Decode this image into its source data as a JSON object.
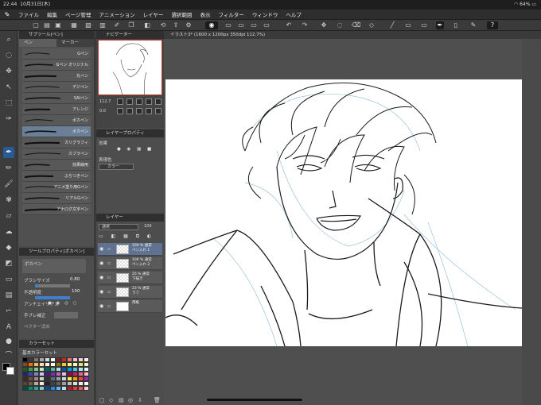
{
  "status": {
    "time": "22:44",
    "date": "10月31日(木)",
    "wifi": "wifi-icon",
    "battery": "64%"
  },
  "menu": [
    "ファイル",
    "編集",
    "ページ管理",
    "アニメーション",
    "レイヤー",
    "選択範囲",
    "表示",
    "フィルター",
    "ウィンドウ",
    "ヘルプ"
  ],
  "subtool": {
    "header": "サブツール[ペン]",
    "tabs": [
      "ペン",
      "マーカー"
    ],
    "brushes": [
      "Gペン",
      "Gペン オリジナル",
      "丸ペン",
      "デジペン",
      "SAIペン",
      "アレンジ",
      "ボカペン",
      "ボカペン",
      "カリグラフィ",
      "カブラペン",
      "効果線用",
      "ぶらつきペン",
      "アニメ塗り用Gペン",
      "リアルGペン",
      "アナログ文字ペン"
    ],
    "selected_index": 7
  },
  "toolprop": {
    "header": "ツールプロパティ[ボカペン]",
    "brush_name": "ボカペン",
    "brush_size_label": "ブラシサイズ",
    "brush_size_value": "0.80",
    "opacity_label": "不透明度",
    "opacity_value": "100",
    "opacity_fraction": 1.0,
    "brush_size_fraction": 0.08,
    "antialias_label": "アンチエイリアス",
    "stabilize_label": "手ブレ補正",
    "vector_label": "ベクター消去"
  },
  "colorset": {
    "header": "カラーセット",
    "set_name": "基本カラーセット"
  },
  "navigator": {
    "header": "ナビゲーター",
    "zoom": "112.7",
    "rotate": "0.0"
  },
  "layerprop": {
    "header": "レイヤープロパティ",
    "effect_label": "効果",
    "expression_label": "表現色",
    "color_value": "カラー"
  },
  "layers": {
    "header": "レイヤー",
    "blend_mode": "通常",
    "opacity": "100",
    "items": [
      {
        "line1": "100 % 通常",
        "line2": "ペン入れ 1"
      },
      {
        "line1": "100 % 通常",
        "line2": "ペン入れ 2"
      },
      {
        "line1": "25 % 通常",
        "line2": "下描き"
      },
      {
        "line1": "23 % 通常",
        "line2": "ラフ"
      },
      {
        "line1": "",
        "line2": "用紙"
      }
    ],
    "selected_index": 0
  },
  "canvas": {
    "tab_title": "イラスト3* (1600 x 1200px 350dpi 112.7%)"
  },
  "colors": {
    "accent": "#2a5a95",
    "panel_bg": "#4d4d4d",
    "selected_row": "#5f7391",
    "nav_border": "#c0392b"
  },
  "swatch_palette": [
    "#000000",
    "#3a3a3a",
    "#777777",
    "#aaaaaa",
    "#d9d9d9",
    "#ffffff",
    "#7a1f1f",
    "#c62828",
    "#e57373",
    "#f8bbd0",
    "#ffcdd2",
    "#fff0f0",
    "#8d4a12",
    "#ef6c00",
    "#ffb74d",
    "#ffe0b2",
    "#fff3e0",
    "#fffde7",
    "#827717",
    "#fbc02d",
    "#fff176",
    "#fff9c4",
    "#dce775",
    "#f0f4c3",
    "#1b5e20",
    "#43a047",
    "#81c784",
    "#c8e6c9",
    "#00695c",
    "#4db6ac",
    "#b2dfdb",
    "#01579b",
    "#039be5",
    "#4fc3f7",
    "#b3e5fc",
    "#e1f5fe",
    "#1a237e",
    "#3949ab",
    "#7986cb",
    "#c5cae9",
    "#4a148c",
    "#8e24aa",
    "#ba68c8",
    "#e1bee7",
    "#880e4f",
    "#d81b60",
    "#f06292",
    "#f8bbd0",
    "#3e2723",
    "#6d4c41",
    "#a1887f",
    "#d7ccc8",
    "#263238",
    "#546e7a",
    "#90a4ae",
    "#cfd8dc",
    "#ffeb3b",
    "#ff9800",
    "#f44336",
    "#9c27b0",
    "#5d4037",
    "#795548",
    "#bcaaa4",
    "#efebe9",
    "#212121",
    "#424242",
    "#616161",
    "#9e9e9e",
    "#bdbdbd",
    "#e0e0e0",
    "#eeeeee",
    "#fafafa",
    "#004d40",
    "#00897b",
    "#26a69a",
    "#80cbc4",
    "#0d47a1",
    "#1e88e5",
    "#64b5f6",
    "#bbdefb",
    "#b71c1c",
    "#e53935",
    "#ef5350",
    "#ffcdd2"
  ]
}
